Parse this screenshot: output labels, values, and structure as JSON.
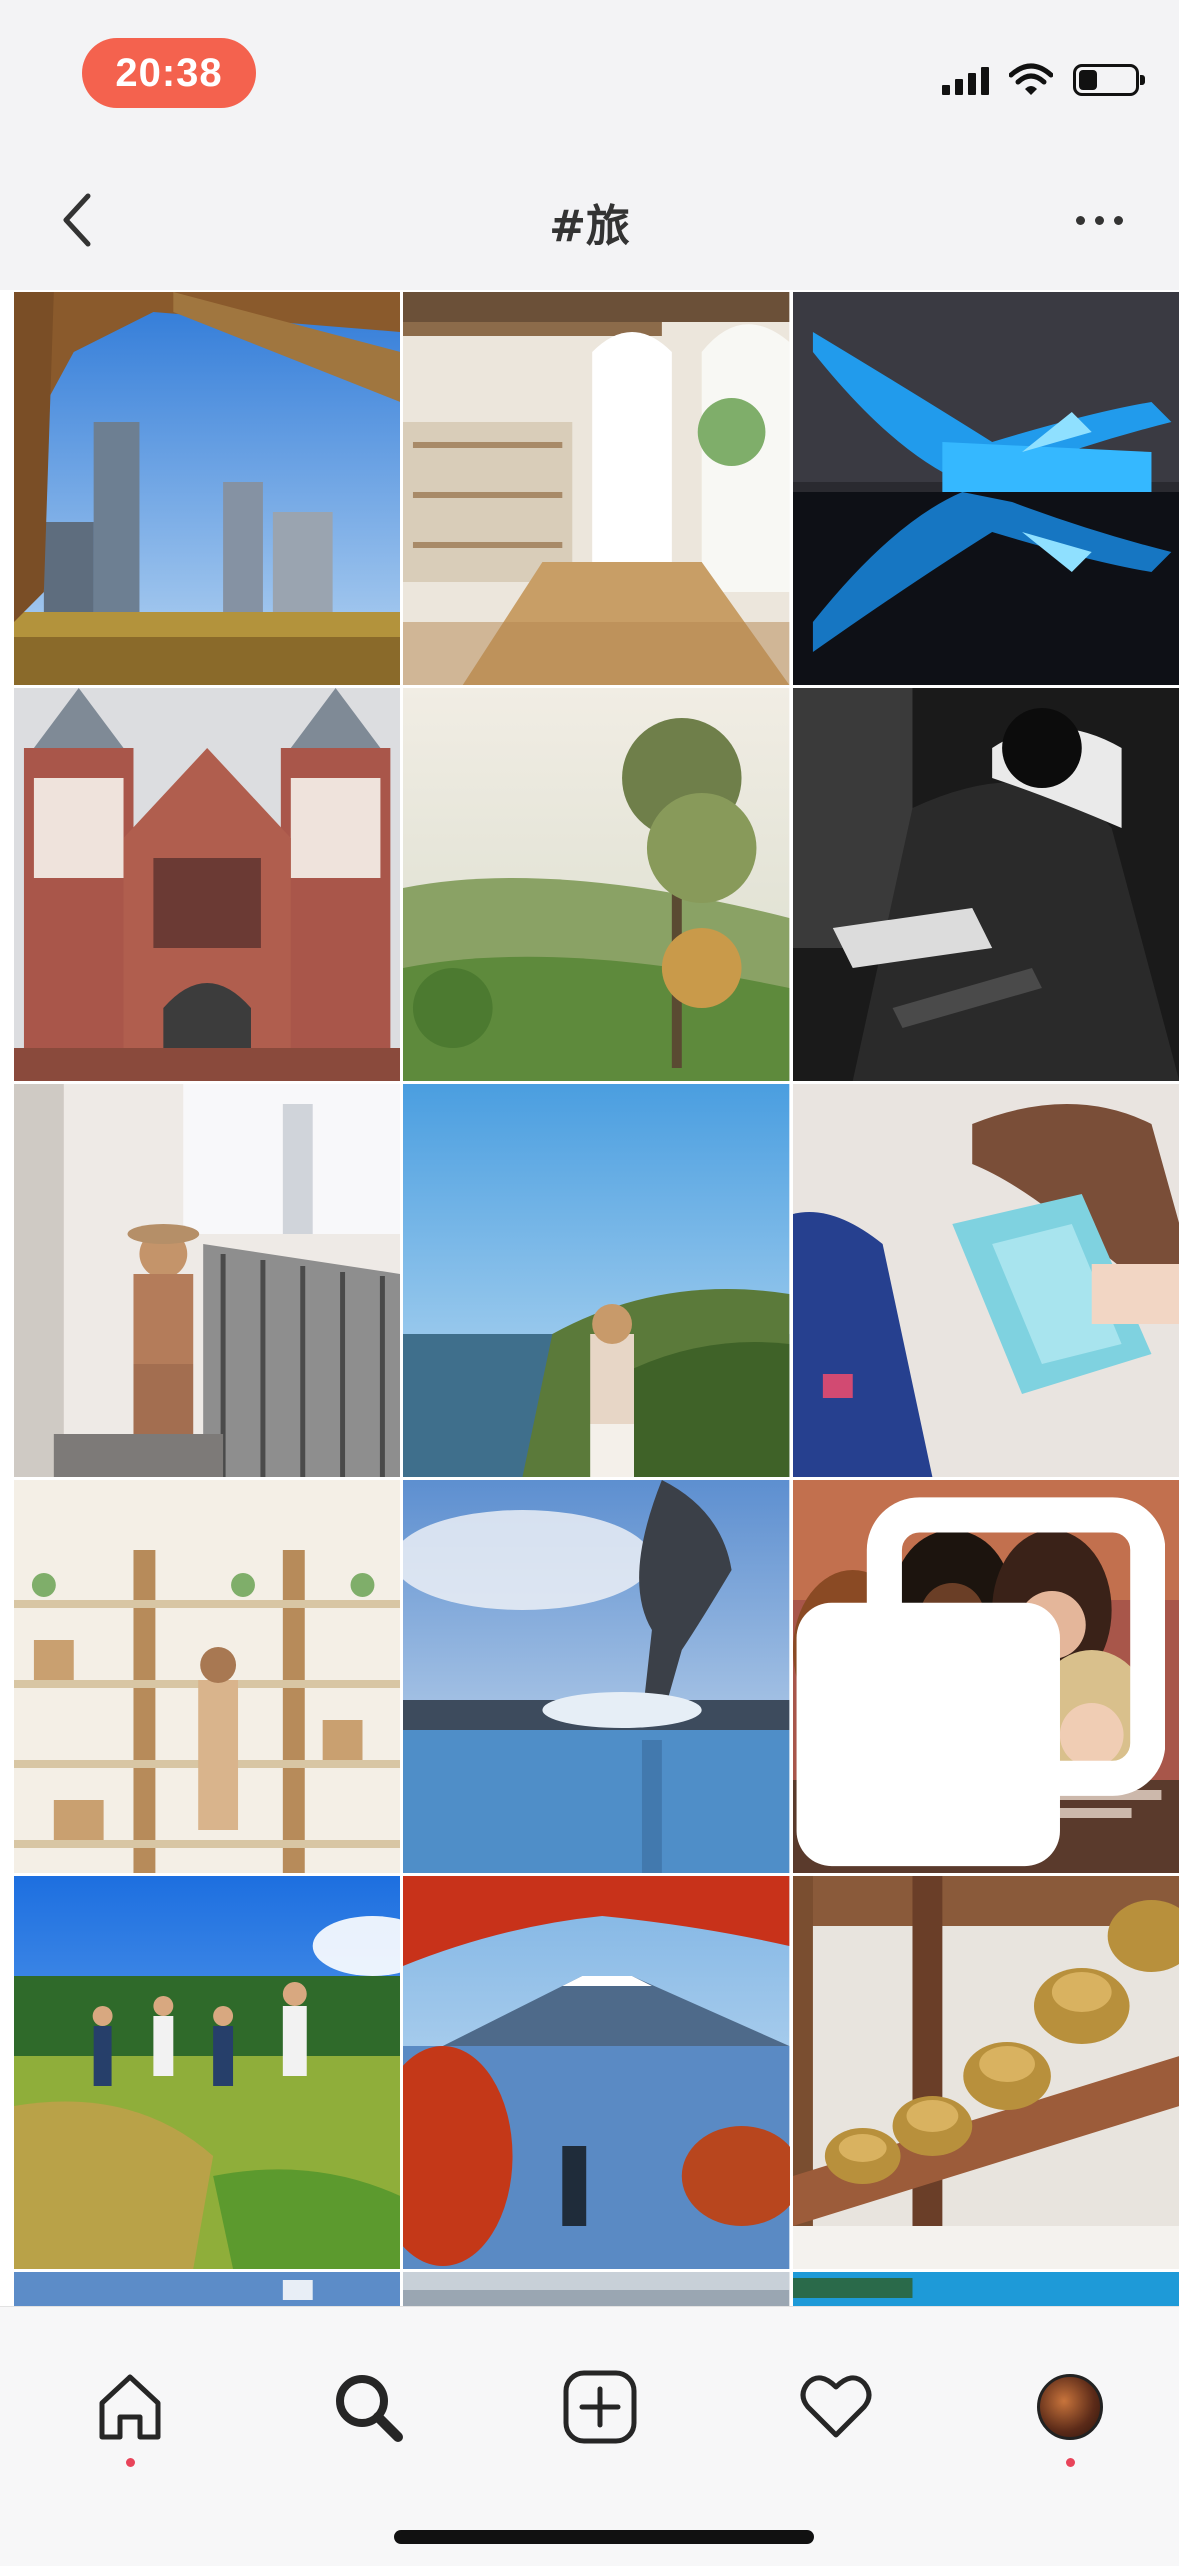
{
  "status_bar": {
    "time": "20:38",
    "icons": [
      "signal-icon",
      "wifi-icon",
      "battery-icon"
    ]
  },
  "nav": {
    "title": "#旅",
    "back_icon": "chevron-left-icon",
    "more_icon": "ellipsis-icon"
  },
  "grid": {
    "posts": [
      {
        "subject": "city-skyline-bridge"
      },
      {
        "subject": "white-cafe-interior"
      },
      {
        "subject": "blue-lit-sculpture"
      },
      {
        "subject": "brick-church"
      },
      {
        "subject": "misty-forest-hills"
      },
      {
        "subject": "monochrome-portrait"
      },
      {
        "subject": "woman-on-balcony"
      },
      {
        "subject": "coastal-cliff"
      },
      {
        "subject": "woman-with-passport"
      },
      {
        "subject": "shop-shelves"
      },
      {
        "subject": "hot-spring-lake"
      },
      {
        "subject": "group-of-friends",
        "multi_icon": "multiple-images-icon"
      },
      {
        "subject": "rice-field-friends"
      },
      {
        "subject": "mount-fuji-autumn"
      },
      {
        "subject": "gold-roof-ornaments"
      },
      {
        "subject": "partial-row"
      },
      {
        "subject": "partial-row"
      },
      {
        "subject": "partial-row"
      }
    ]
  },
  "tab_bar": {
    "tabs": [
      {
        "icon": "home-icon",
        "active": false,
        "notification_dot": true
      },
      {
        "icon": "search-icon",
        "active": true,
        "notification_dot": false
      },
      {
        "icon": "add-post-icon",
        "active": false,
        "notification_dot": false
      },
      {
        "icon": "heart-icon",
        "active": false,
        "notification_dot": false
      },
      {
        "icon": "profile-avatar-icon",
        "active": false,
        "notification_dot": true
      }
    ]
  },
  "colors": {
    "time_pill": "#f4624e",
    "notification_dot": "#e8445a",
    "bar_background": "#f3f3f5"
  }
}
